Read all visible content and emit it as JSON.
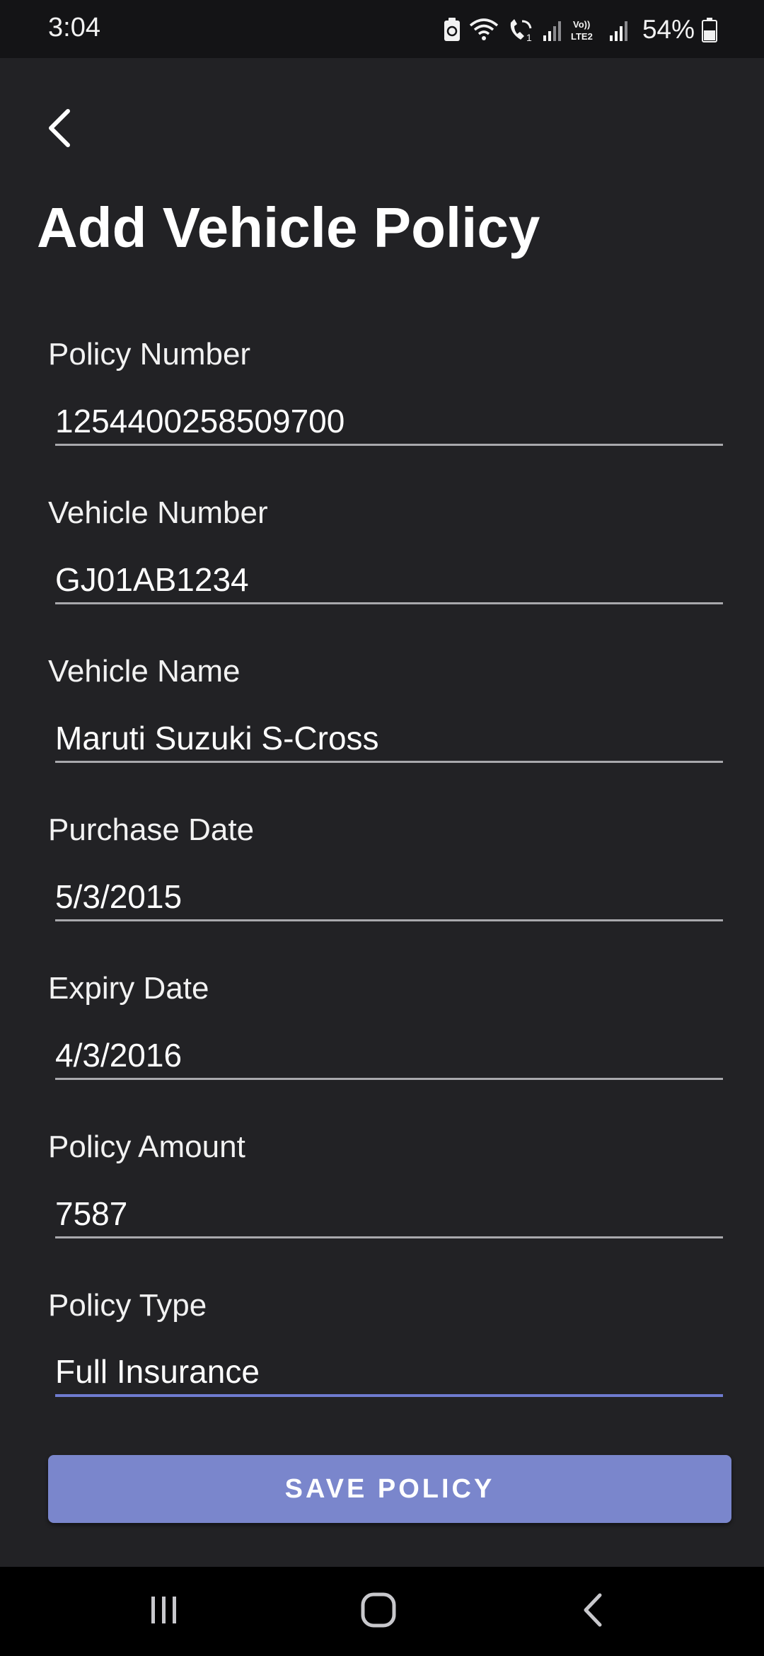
{
  "status_bar": {
    "time": "3:04",
    "battery_percent": "54%",
    "icons": [
      "battery-saver-icon",
      "wifi-icon",
      "wifi-call-icon",
      "signal-icon",
      "volte-lte2-icon",
      "signal-icon",
      "battery-icon"
    ]
  },
  "header": {
    "back_icon": "chevron-left-icon",
    "title": "Add Vehicle Policy"
  },
  "form": {
    "fields": [
      {
        "label": "Policy Number",
        "value": "1254400258509700"
      },
      {
        "label": "Vehicle Number",
        "value": "GJ01AB1234"
      },
      {
        "label": "Vehicle Name",
        "value": "Maruti Suzuki S-Cross"
      },
      {
        "label": "Purchase Date",
        "value": "5/3/2015"
      },
      {
        "label": "Expiry Date",
        "value": "4/3/2016"
      },
      {
        "label": "Policy Amount",
        "value": "7587"
      },
      {
        "label": "Policy Type",
        "value": "Full Insurance"
      }
    ],
    "save_label": "SAVE POLICY"
  },
  "colors": {
    "background": "#222225",
    "accent": "#7a86cc",
    "focus_underline": "#6f7bd0"
  },
  "nav_bar": {
    "icons": [
      "recent-apps-icon",
      "home-icon",
      "back-icon"
    ]
  }
}
